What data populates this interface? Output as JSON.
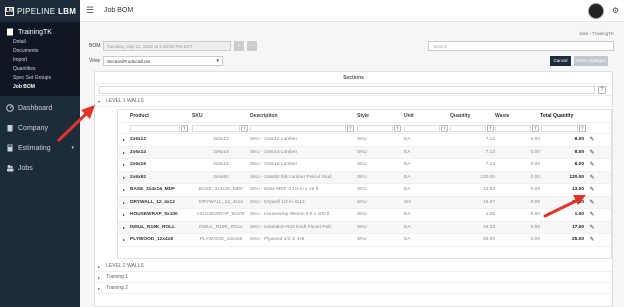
{
  "brand": {
    "mark": "LM",
    "name_light": "PIPELINE",
    "name_bold": "LBM"
  },
  "header": {
    "title": "Job BOM",
    "gear_icon": "gear-icon",
    "avatar": "user-avatar"
  },
  "sidebar": {
    "active_label": "TrainingTK",
    "sub_items": [
      "Detail",
      "Documents",
      "Import",
      "Quantities",
      "Spec Set Groups",
      "Job BOM"
    ],
    "items": [
      {
        "label": "Dashboard",
        "icon": "dashboard-icon"
      },
      {
        "label": "Company",
        "icon": "building-icon"
      },
      {
        "label": "Estimating",
        "icon": "calculator-icon",
        "caret": "▾"
      },
      {
        "label": "Jobs",
        "icon": "people-icon"
      }
    ]
  },
  "breadcrumb": "Jobs  ›  TrainingTK",
  "bom": {
    "label": "BOM",
    "value": "Tuesday, July 12, 2022 at 4:40:00 PM EDT"
  },
  "view": {
    "label": "View",
    "value": "Section/Products/Use"
  },
  "search": {
    "placeholder": "Search"
  },
  "buttons": {
    "cancel": "Cancel",
    "save": "Save Changes"
  },
  "sections": {
    "header": "Sections",
    "expanded": {
      "label": "LEVEL 1 WALLS",
      "toggle": "▾"
    },
    "collapsed": [
      {
        "label": "LEVEL 2 WALLS",
        "toggle": "▸"
      },
      {
        "label": "Training 1",
        "toggle": "▸"
      },
      {
        "label": "Training 2",
        "toggle": "▸"
      }
    ]
  },
  "table": {
    "columns": [
      "Product",
      "SKU",
      "Description",
      "Style",
      "Unit",
      "Quantity",
      "Waste",
      "Total Quantity"
    ],
    "rows": [
      {
        "product": "2x6x12",
        "sku": "2x6x12",
        "description": "SKU - 2x6x12 Lumber",
        "style": "SKU",
        "unit": "EA",
        "quantity": "7.14",
        "waste": "0.00",
        "total": "8.00"
      },
      {
        "product": "2x6x14",
        "sku": "2x6x14",
        "description": "SKU - 2x6x14 Lumber",
        "style": "SKU",
        "unit": "EA",
        "quantity": "7.14",
        "waste": "0.00",
        "total": "8.00"
      },
      {
        "product": "2x6x16",
        "sku": "2x6x16",
        "description": "SKU - 2x6x16 Lumber",
        "style": "SKU",
        "unit": "EA",
        "quantity": "7.14",
        "waste": "0.00",
        "total": "8.00"
      },
      {
        "product": "2x6x92",
        "sku": "2x6x92",
        "description": "SKU - 2x6x92 5/8 Lumber Precut Stud",
        "style": "SKU",
        "unit": "EA",
        "quantity": "120.00",
        "waste": "0.00",
        "total": "120.00"
      },
      {
        "product": "BASE_314x16_MDF",
        "sku": "BASE_314x16_MDF",
        "description": "SKU - Base MDF 3 1/4 in x 16 ft",
        "style": "SKU",
        "unit": "EA",
        "quantity": "12.50",
        "waste": "0.00",
        "total": "13.00"
      },
      {
        "product": "DRYWALL_12_4x12",
        "sku": "DRYWALL_12_4x12",
        "description": "SKU - Drywall 1/2 in 4x12",
        "style": "SKU",
        "unit": "SH",
        "quantity": "16.67",
        "waste": "0.00",
        "total": "17.00"
      },
      {
        "product": "HOUSEWRAP_9x100",
        "sku": "HOUSEWRAP_9x100",
        "description": "SKU - Housewrap Weson 9 ft x 100 ft",
        "style": "SKU",
        "unit": "EA",
        "quantity": "1.00",
        "waste": "0.00",
        "total": "1.00"
      },
      {
        "product": "INSUL_R19K_ROLL",
        "sku": "INSUL_R19K_ROLL",
        "description": "SKU - Insulation R19 Kraft Faced Roll",
        "style": "SKU",
        "unit": "EA",
        "quantity": "16.33",
        "waste": "0.00",
        "total": "17.00"
      },
      {
        "product": "PLYWOOD_12x4x8",
        "sku": "PLYWOOD_12x4x8",
        "description": "SKU - Plywood 1/2 in 4x8",
        "style": "SKU",
        "unit": "EA",
        "quantity": "25.00",
        "waste": "0.00",
        "total": "25.00"
      }
    ]
  },
  "annotation_color": "#e0332a"
}
